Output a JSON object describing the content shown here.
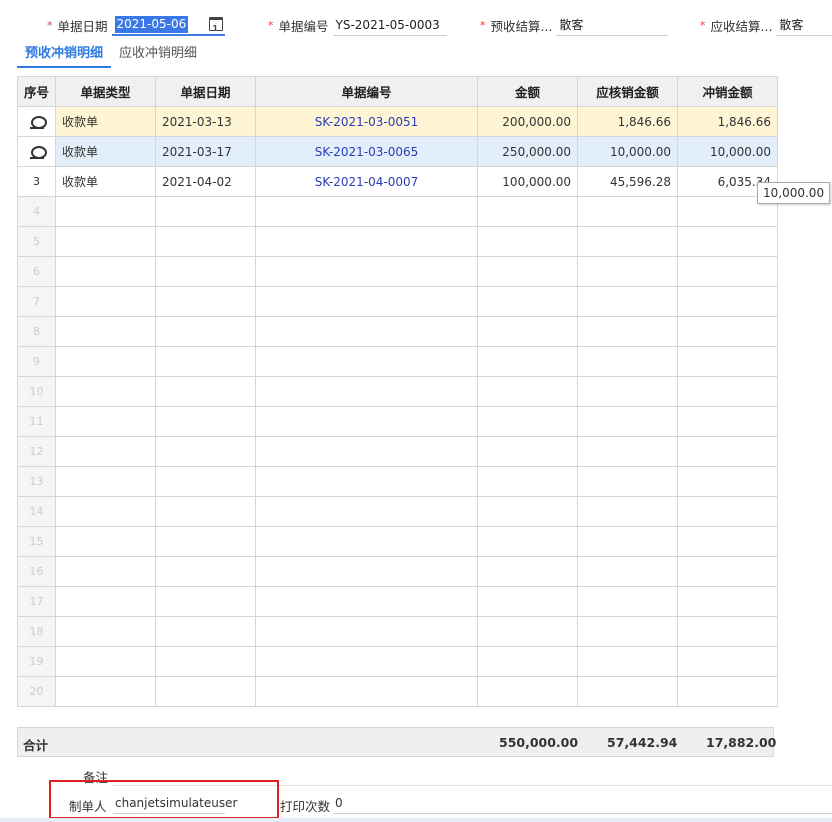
{
  "header": {
    "date": {
      "label": "单据日期",
      "value": "2021-05-06"
    },
    "number": {
      "label": "单据编号",
      "value": "YS-2021-05-0003"
    },
    "prepay_party": {
      "label": "预收结算...",
      "value": "散客"
    },
    "receivable_party": {
      "label": "应收结算...",
      "value": "散客"
    }
  },
  "tabs": [
    {
      "label": "预收冲销明细",
      "active": true
    },
    {
      "label": "应收冲销明细",
      "active": false
    }
  ],
  "table": {
    "columns": [
      "序号",
      "单据类型",
      "单据日期",
      "单据编号",
      "金额",
      "应核销金额",
      "冲销金额"
    ],
    "rows": [
      {
        "seq": "",
        "icon": "gear-icon",
        "type": "收款单",
        "date": "2021-03-13",
        "code": "SK-2021-03-0051",
        "amount": "200,000.00",
        "due": "1,846.66",
        "offset": "1,846.66"
      },
      {
        "seq": "",
        "icon": "gear-icon",
        "type": "收款单",
        "date": "2021-03-17",
        "code": "SK-2021-03-0065",
        "amount": "250,000.00",
        "due": "10,000.00",
        "offset": "10,000.00"
      },
      {
        "seq": "3",
        "type": "收款单",
        "date": "2021-04-02",
        "code": "SK-2021-04-0007",
        "amount": "100,000.00",
        "due": "45,596.28",
        "offset": "6,035.34"
      }
    ],
    "empty_rows": [
      "4",
      "5",
      "6",
      "7",
      "8",
      "9",
      "10",
      "11",
      "12",
      "13",
      "14",
      "15",
      "16",
      "17",
      "18",
      "19",
      "20"
    ]
  },
  "tooltip": "10,000.00",
  "totals": {
    "label": "合计",
    "amount": "550,000.00",
    "due": "57,442.94",
    "offset": "17,882.00"
  },
  "footer": {
    "remark_label": "备注",
    "maker_label": "制单人",
    "maker_value": "chanjetsimulateuser",
    "print_label": "打印次数",
    "print_value": "0"
  }
}
